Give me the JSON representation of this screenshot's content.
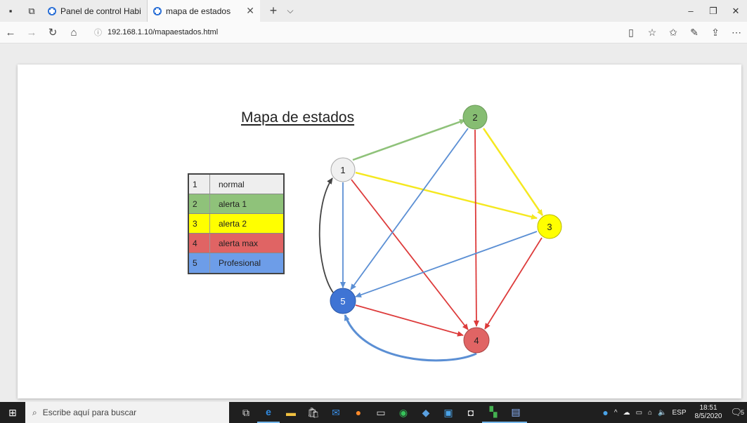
{
  "browser": {
    "tabs": [
      {
        "label": "Panel de control Habitacion"
      },
      {
        "label": "mapa de estados"
      }
    ],
    "address": "192.168.1.10/mapaestados.html"
  },
  "page": {
    "title": "Mapa de estados",
    "legend": [
      {
        "num": "1",
        "label": "normal",
        "color": "#eeeeee"
      },
      {
        "num": "2",
        "label": "alerta 1",
        "color": "#8fc27a"
      },
      {
        "num": "3",
        "label": "alerta 2",
        "color": "#ffff00"
      },
      {
        "num": "4",
        "label": "alerta max",
        "color": "#e06464"
      },
      {
        "num": "5",
        "label": "Profesional",
        "color": "#6d9de8"
      }
    ],
    "nodes": [
      {
        "id": "1",
        "fill": "#f0f0f0"
      },
      {
        "id": "2",
        "fill": "#86bd72"
      },
      {
        "id": "3",
        "fill": "#ffff00"
      },
      {
        "id": "4",
        "fill": "#e06464"
      },
      {
        "id": "5",
        "fill": "#3f74d4"
      }
    ]
  },
  "taskbar": {
    "search_placeholder": "Escribe aquí para buscar",
    "language": "ESP",
    "time": "18:51",
    "date": "8/5/2020",
    "notifications": "5"
  },
  "colors": {
    "green_edge": "#8fc27a",
    "yellow_edge": "#f5e820",
    "red_edge": "#dd3b3b",
    "blue_edge": "#5b8fd4",
    "black_edge": "#444444"
  }
}
